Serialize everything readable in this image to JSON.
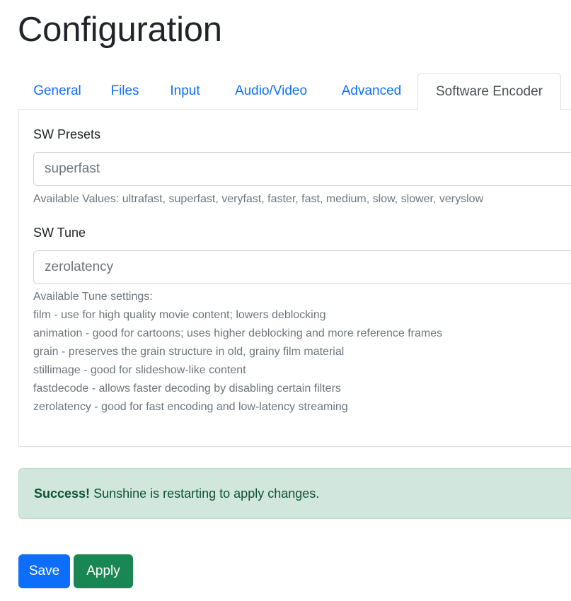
{
  "page": {
    "title": "Configuration"
  },
  "tabs": [
    {
      "label": "General",
      "active": false
    },
    {
      "label": "Files",
      "active": false
    },
    {
      "label": "Input",
      "active": false
    },
    {
      "label": "Audio/Video",
      "active": false
    },
    {
      "label": "Advanced",
      "active": false
    },
    {
      "label": "Software Encoder",
      "active": true
    }
  ],
  "sw_presets": {
    "label": "SW Presets",
    "value": "superfast",
    "help": "Available Values: ultrafast, superfast, veryfast, faster, fast, medium, slow, slower, veryslow"
  },
  "sw_tune": {
    "label": "SW Tune",
    "value": "zerolatency",
    "help_lines": [
      "Available Tune settings:",
      "film - use for high quality movie content; lowers deblocking",
      "animation - good for cartoons; uses higher deblocking and more reference frames",
      "grain - preserves the grain structure in old, grainy film material",
      "stillimage - good for slideshow-like content",
      "fastdecode - allows faster decoding by disabling certain filters",
      "zerolatency - good for fast encoding and low-latency streaming"
    ]
  },
  "alert": {
    "strong": "Success!",
    "message": " Sunshine is restarting to apply changes."
  },
  "actions": {
    "save_label": "Save",
    "apply_label": "Apply"
  },
  "colors": {
    "primary": "#0d6efd",
    "success": "#198754",
    "alert_bg": "#d1e7dd",
    "alert_text": "#0f5132"
  }
}
